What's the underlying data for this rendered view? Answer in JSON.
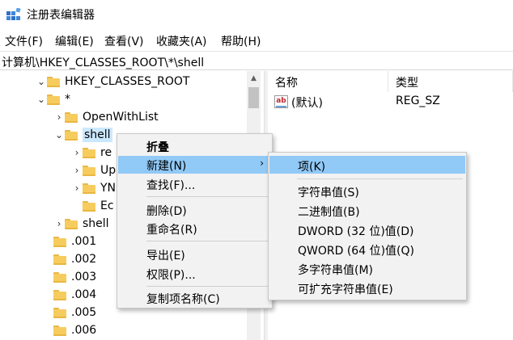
{
  "window": {
    "title": "注册表编辑器",
    "app_icon": "registry-editor-icon"
  },
  "menubar": {
    "items": [
      "文件(F)",
      "编辑(E)",
      "查看(V)",
      "收藏夹(A)",
      "帮助(H)"
    ]
  },
  "address": {
    "path": "计算机\\HKEY_CLASSES_ROOT\\*\\shell"
  },
  "tree": {
    "items": [
      {
        "label": "HKEY_CLASSES_ROOT",
        "expander": "expanded"
      },
      {
        "label": "*",
        "expander": "expanded"
      },
      {
        "label": "OpenWithList",
        "expander": "collapsed"
      },
      {
        "label": "shell",
        "expander": "expanded",
        "selected": true
      },
      {
        "label": "re",
        "expander": "collapsed"
      },
      {
        "label": "Up",
        "expander": "collapsed"
      },
      {
        "label": "YN",
        "expander": "collapsed"
      },
      {
        "label": "Ec",
        "expander": "none"
      },
      {
        "label": "shell",
        "expander": "collapsed"
      },
      {
        "label": ".001",
        "expander": "none"
      },
      {
        "label": ".002",
        "expander": "none"
      },
      {
        "label": ".003",
        "expander": "none"
      },
      {
        "label": ".004",
        "expander": "none"
      },
      {
        "label": ".005",
        "expander": "none"
      },
      {
        "label": ".006",
        "expander": "none"
      }
    ]
  },
  "list": {
    "columns": [
      "名称",
      "类型"
    ],
    "rows": [
      {
        "name": "(默认)",
        "type": "REG_SZ",
        "icon": "string-value-icon",
        "icon_text": "ab"
      }
    ]
  },
  "context_menu": {
    "items": [
      {
        "label": "折叠",
        "bold": true
      },
      {
        "label": "新建(N)",
        "submenu": true,
        "hover": true
      },
      {
        "label": "查找(F)..."
      },
      {
        "label": "删除(D)"
      },
      {
        "label": "重命名(R)"
      },
      {
        "label": "导出(E)"
      },
      {
        "label": "权限(P)..."
      },
      {
        "label": "复制项名称(C)"
      }
    ],
    "submenu_arrow": "›"
  },
  "new_submenu": {
    "items": [
      {
        "label": "项(K)",
        "hover": true
      },
      {
        "label": "字符串值(S)"
      },
      {
        "label": "二进制值(B)"
      },
      {
        "label": "DWORD (32 位)值(D)"
      },
      {
        "label": "QWORD (64 位)值(Q)"
      },
      {
        "label": "多字符串值(M)"
      },
      {
        "label": "可扩充字符串值(E)"
      }
    ]
  },
  "colors": {
    "hover": "#91c9f7",
    "selection": "#cce8ff",
    "menu_bg": "#f2f2f2"
  }
}
